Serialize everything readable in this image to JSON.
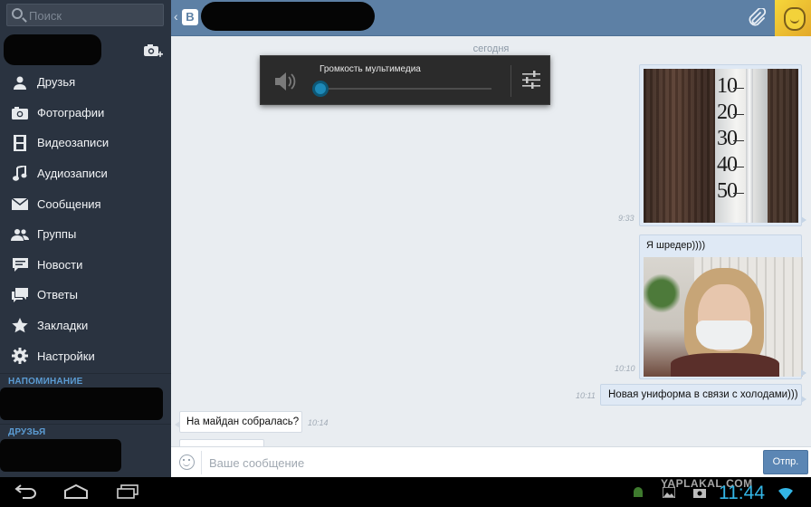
{
  "sidebar": {
    "search_placeholder": "Поиск",
    "items": [
      {
        "label": "Друзья",
        "icon": "person-icon"
      },
      {
        "label": "Фотографии",
        "icon": "camera-icon"
      },
      {
        "label": "Видеозаписи",
        "icon": "film-icon"
      },
      {
        "label": "Аудиозаписи",
        "icon": "music-note-icon"
      },
      {
        "label": "Сообщения",
        "icon": "envelope-icon"
      },
      {
        "label": "Группы",
        "icon": "people-icon"
      },
      {
        "label": "Новости",
        "icon": "news-icon"
      },
      {
        "label": "Ответы",
        "icon": "replies-icon"
      },
      {
        "label": "Закладки",
        "icon": "star-icon"
      },
      {
        "label": "Настройки",
        "icon": "gear-icon"
      }
    ],
    "section_reminder": "НАПОМИНАНИЕ",
    "section_friends": "ДРУЗЬЯ"
  },
  "header": {
    "logo_letter": "В"
  },
  "chat": {
    "date_separator": "сегодня",
    "messages": [
      {
        "direction": "out",
        "type": "photo",
        "time": "9:33",
        "photo_numbers": [
          "10",
          "20",
          "30",
          "40",
          "50"
        ]
      },
      {
        "direction": "out",
        "type": "text+photo",
        "text": "Я шредер))))",
        "time": "10:10"
      },
      {
        "direction": "out",
        "type": "text",
        "text": "Новая униформа в связи с холодами)))",
        "time": "10:11"
      },
      {
        "direction": "in",
        "type": "text",
        "text": "На майдан собралась?",
        "time": "10:14"
      }
    ]
  },
  "volume_overlay": {
    "title": "Громкость мультимедиа",
    "level": 0
  },
  "composer": {
    "placeholder": "Ваше сообщение",
    "send_label": "Отпр."
  },
  "system_bar": {
    "time": "11:44",
    "watermark": "YAPLAKAL.COM"
  },
  "colors": {
    "header": "#5d80a5",
    "sidebar": "#2a3340",
    "section_header": "#5b9bd2",
    "clock": "#33b5e5",
    "volume_knob": "#1d89b8",
    "send_button": "#5b86b4"
  }
}
